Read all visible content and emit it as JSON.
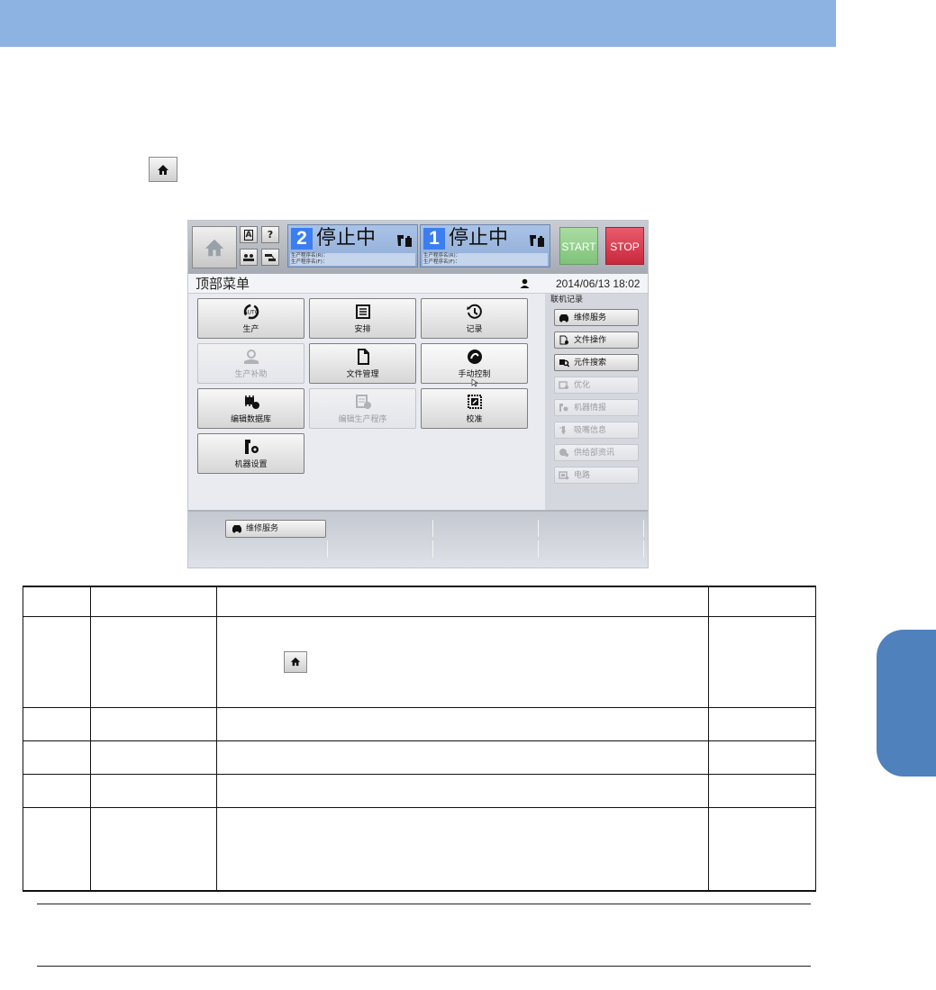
{
  "machine": {
    "lane2": {
      "num": "2",
      "status": "停止中",
      "prog_r": "生产程序名(R)：",
      "prog_f": "生产程序名(F)："
    },
    "lane1": {
      "num": "1",
      "status": "停止中",
      "prog_r": "生产程序名(R)：",
      "prog_f": "生产程序名(F)："
    },
    "start_label": "START",
    "stop_label": "STOP",
    "small_buttons": [
      "A",
      "?"
    ],
    "title": "顶部菜单",
    "datetime": "2014/06/13 18:02",
    "menu": [
      {
        "label": "生产",
        "icon": "auto-cycle-icon",
        "enabled": true
      },
      {
        "label": "安排",
        "icon": "checklist-icon",
        "enabled": true
      },
      {
        "label": "记录",
        "icon": "history-icon",
        "enabled": true
      },
      {
        "label": "生产补助",
        "icon": "assist-hand-icon",
        "enabled": false
      },
      {
        "label": "文件管理",
        "icon": "document-icon",
        "enabled": true
      },
      {
        "label": "手动控制",
        "icon": "manual-hand-icon",
        "enabled": true
      },
      {
        "label": "编辑数据库",
        "icon": "component-edit-icon",
        "enabled": true
      },
      {
        "label": "编辑生产程序",
        "icon": "program-edit-icon",
        "enabled": false
      },
      {
        "label": "校准",
        "icon": "calibrate-icon",
        "enabled": true
      },
      {
        "label": "机器设置",
        "icon": "machine-settings-icon",
        "enabled": true
      }
    ],
    "side_header": "联机记录",
    "side": [
      {
        "label": "维修服务",
        "icon": "service-car-icon",
        "enabled": true
      },
      {
        "label": "文件操作",
        "icon": "file-operation-icon",
        "enabled": true
      },
      {
        "label": "元件搜索",
        "icon": "part-search-icon",
        "enabled": true
      },
      {
        "label": "优化",
        "icon": "optimize-icon",
        "enabled": false
      },
      {
        "label": "机器情报",
        "icon": "machine-info-icon",
        "enabled": false
      },
      {
        "label": "吸嘴信息",
        "icon": "nozzle-info-icon",
        "enabled": false
      },
      {
        "label": "供给部资讯",
        "icon": "feeder-info-icon",
        "enabled": false
      },
      {
        "label": "电路",
        "icon": "circuit-icon",
        "enabled": false
      }
    ],
    "bottom_button": "维修服务"
  },
  "colors": {
    "band": "#8db3e2",
    "tab": "#4f81bd",
    "start": "#8fcd88",
    "stop": "#d7354a",
    "lane_num": "#3c7ef0"
  }
}
